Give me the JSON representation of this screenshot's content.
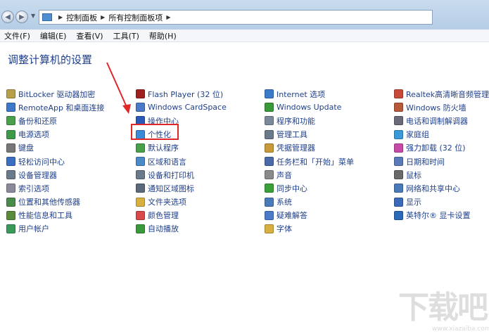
{
  "addressbar": {
    "crumbs": [
      "控制面板",
      "所有控制面板项"
    ]
  },
  "menu": [
    "文件(F)",
    "编辑(E)",
    "查看(V)",
    "工具(T)",
    "帮助(H)"
  ],
  "page_title": "调整计算机的设置",
  "columns": [
    [
      {
        "label": "BitLocker 驱动器加密",
        "icon": "bitlocker-icon",
        "color": "#b8a04a"
      },
      {
        "label": "RemoteApp 和桌面连接",
        "icon": "remoteapp-icon",
        "color": "#3e78c8"
      },
      {
        "label": "备份和还原",
        "icon": "backup-icon",
        "color": "#4aa04a"
      },
      {
        "label": "电源选项",
        "icon": "power-icon",
        "color": "#3e9a4a"
      },
      {
        "label": "键盘",
        "icon": "keyboard-icon",
        "color": "#777777"
      },
      {
        "label": "轻松访问中心",
        "icon": "ease-of-access-icon",
        "color": "#3a6fc4"
      },
      {
        "label": "设备管理器",
        "icon": "device-manager-icon",
        "color": "#6a7a8a"
      },
      {
        "label": "索引选项",
        "icon": "indexing-icon",
        "color": "#8a8a9a"
      },
      {
        "label": "位置和其他传感器",
        "icon": "sensor-icon",
        "color": "#4a8a4a"
      },
      {
        "label": "性能信息和工具",
        "icon": "performance-icon",
        "color": "#5a8a3a"
      },
      {
        "label": "用户帐户",
        "icon": "user-accounts-icon",
        "color": "#3a9a5a"
      }
    ],
    [
      {
        "label": "Flash Player (32 位)",
        "icon": "flash-icon",
        "color": "#a02020"
      },
      {
        "label": "Windows CardSpace",
        "icon": "cardspace-icon",
        "color": "#4a7ac8"
      },
      {
        "label": "操作中心",
        "icon": "flag-icon",
        "color": "#2a5ab8"
      },
      {
        "label": "个性化",
        "icon": "personalization-icon",
        "color": "#3a8ad8"
      },
      {
        "label": "默认程序",
        "icon": "default-programs-icon",
        "color": "#4aa04a"
      },
      {
        "label": "区域和语言",
        "icon": "region-icon",
        "color": "#4a8ac8"
      },
      {
        "label": "设备和打印机",
        "icon": "printer-icon",
        "color": "#6a7a8a"
      },
      {
        "label": "通知区域图标",
        "icon": "notification-icon",
        "color": "#5a6a7a"
      },
      {
        "label": "文件夹选项",
        "icon": "folder-options-icon",
        "color": "#d8b040"
      },
      {
        "label": "颜色管理",
        "icon": "color-management-icon",
        "color": "#d84a4a"
      },
      {
        "label": "自动播放",
        "icon": "autoplay-icon",
        "color": "#3a9a3a"
      }
    ],
    [
      {
        "label": "Internet 选项",
        "icon": "internet-options-icon",
        "color": "#3a7ac8"
      },
      {
        "label": "Windows Update",
        "icon": "windows-update-icon",
        "color": "#3a9a3a"
      },
      {
        "label": "程序和功能",
        "icon": "programs-icon",
        "color": "#7a8a9a"
      },
      {
        "label": "管理工具",
        "icon": "admin-tools-icon",
        "color": "#6a7a8a"
      },
      {
        "label": "凭据管理器",
        "icon": "credential-icon",
        "color": "#c89a3a"
      },
      {
        "label": "任务栏和「开始」菜单",
        "icon": "taskbar-icon",
        "color": "#4a6aa8"
      },
      {
        "label": "声音",
        "icon": "sound-icon",
        "color": "#8a8a8a"
      },
      {
        "label": "同步中心",
        "icon": "sync-icon",
        "color": "#3aa03a"
      },
      {
        "label": "系统",
        "icon": "system-icon",
        "color": "#4a7ab8"
      },
      {
        "label": "疑难解答",
        "icon": "troubleshoot-icon",
        "color": "#4a7ac8"
      },
      {
        "label": "字体",
        "icon": "fonts-icon",
        "color": "#d8b040"
      }
    ],
    [
      {
        "label": "Realtek高清晰音频管理器",
        "icon": "realtek-icon",
        "color": "#c84a3a"
      },
      {
        "label": "Windows 防火墙",
        "icon": "firewall-icon",
        "color": "#b85a3a"
      },
      {
        "label": "电话和调制解调器",
        "icon": "phone-icon",
        "color": "#6a6a7a"
      },
      {
        "label": "家庭组",
        "icon": "homegroup-icon",
        "color": "#3a9ad8"
      },
      {
        "label": "强力卸载 (32 位)",
        "icon": "uninstall-icon",
        "color": "#c84aa8"
      },
      {
        "label": "日期和时间",
        "icon": "clock-icon",
        "color": "#5a7ab8"
      },
      {
        "label": "鼠标",
        "icon": "mouse-icon",
        "color": "#6a6a6a"
      },
      {
        "label": "网络和共享中心",
        "icon": "network-icon",
        "color": "#4a7ab8"
      },
      {
        "label": "显示",
        "icon": "display-icon",
        "color": "#3a6ab8"
      },
      {
        "label": "英特尔® 显卡设置",
        "icon": "intel-graphics-icon",
        "color": "#2a6ab8"
      }
    ]
  ],
  "watermark": {
    "text": "下载吧",
    "sub": "www.xiazaiba.com"
  }
}
